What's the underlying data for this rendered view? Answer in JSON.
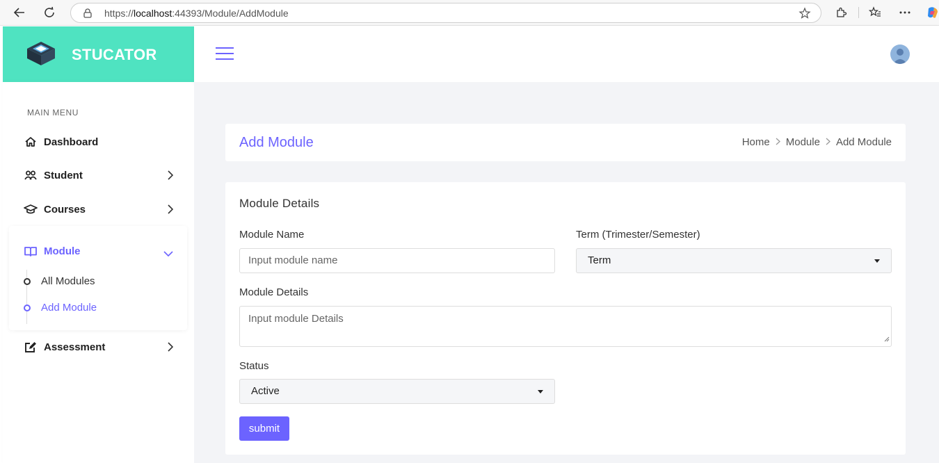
{
  "browser": {
    "url_prefix": "https://",
    "url_host": "localhost",
    "url_rest": ":44393/Module/AddModule"
  },
  "brand": {
    "name": "STUCATOR",
    "color": "#4fe3c1"
  },
  "sidebar": {
    "menu_title": "MAIN MENU",
    "items": [
      {
        "label": "Dashboard",
        "icon": "home-icon"
      },
      {
        "label": "Student",
        "icon": "users-icon"
      },
      {
        "label": "Courses",
        "icon": "graduation-cap-icon"
      },
      {
        "label": "Module",
        "icon": "book-icon",
        "active": true
      },
      {
        "label": "Assessment",
        "icon": "edit-icon"
      }
    ],
    "sub_items": [
      {
        "label": "All Modules"
      },
      {
        "label": "Add Module",
        "active": true
      }
    ]
  },
  "header": {
    "title": "Add Module"
  },
  "breadcrumb": {
    "items": [
      "Home",
      "Module",
      "Add Module"
    ]
  },
  "form": {
    "title": "Module Details",
    "module_name_label": "Module Name",
    "module_name_placeholder": "Input module name",
    "term_label": "Term (Trimester/Semester)",
    "term_value": "Term",
    "details_label": "Module Details",
    "details_placeholder": "Input module Details",
    "status_label": "Status",
    "status_value": "Active",
    "submit_label": "submit"
  },
  "colors": {
    "accent": "#6c63ff",
    "brand": "#4fe3c1",
    "background": "#f3f4f7"
  }
}
